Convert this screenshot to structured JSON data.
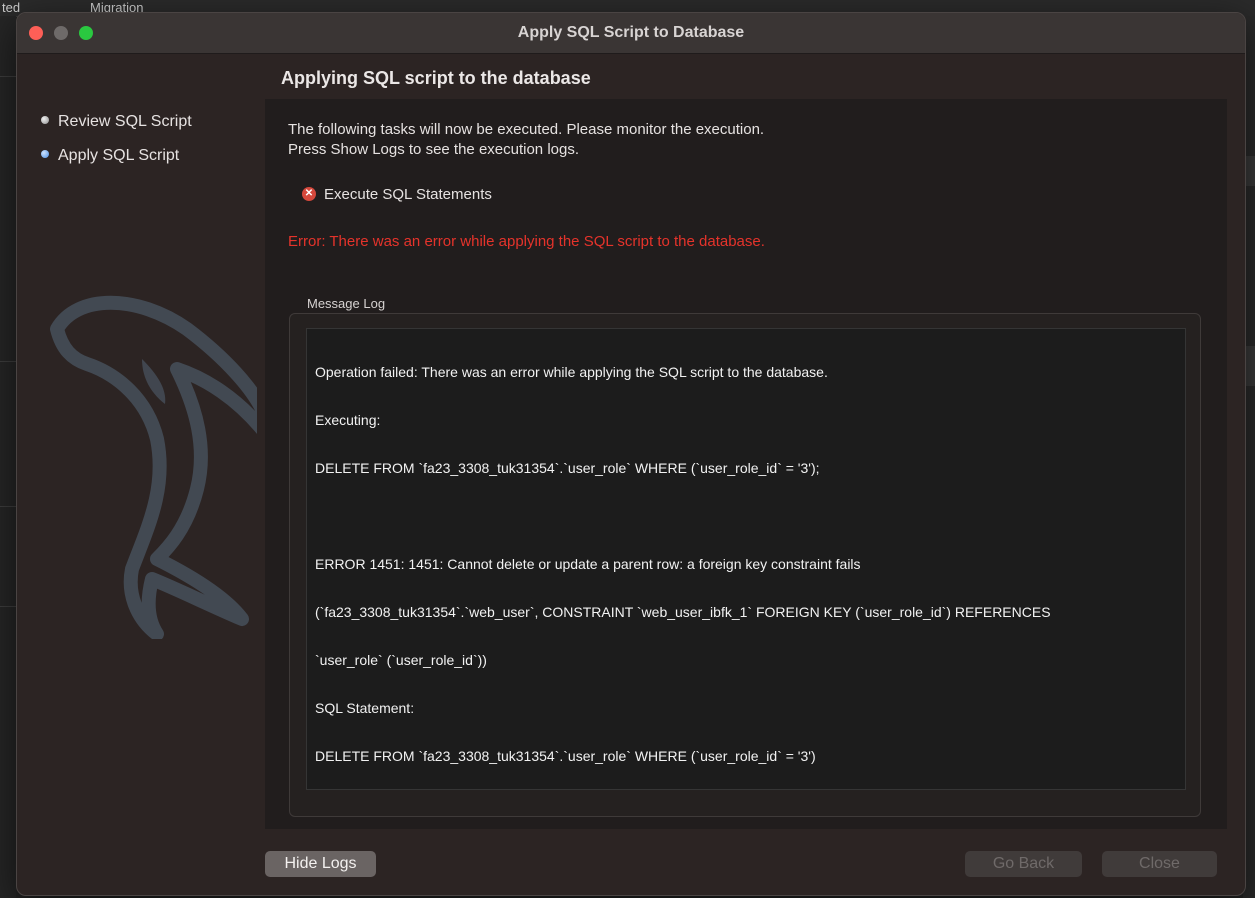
{
  "window": {
    "title": "Apply SQL Script to Database"
  },
  "sidebar": {
    "steps": [
      {
        "label": "Review SQL Script",
        "state": "done"
      },
      {
        "label": "Apply SQL Script",
        "state": "current"
      }
    ]
  },
  "main": {
    "title": "Applying SQL script to the database",
    "description_line1": "The following tasks will now be executed. Please monitor the execution.",
    "description_line2": "Press Show Logs to see the execution logs.",
    "task": {
      "label": "Execute SQL Statements",
      "status": "error"
    },
    "error_message": "Error: There was an error while applying the SQL script to the database.",
    "log": {
      "label": "Message Log",
      "lines": [
        "Operation failed: There was an error while applying the SQL script to the database.",
        "Executing:",
        "DELETE FROM `fa23_3308_tuk31354`.`user_role` WHERE (`user_role_id` = '3');",
        "",
        "ERROR 1451: 1451: Cannot delete or update a parent row: a foreign key constraint fails",
        "(`fa23_3308_tuk31354`.`web_user`, CONSTRAINT `web_user_ibfk_1` FOREIGN KEY (`user_role_id`) REFERENCES",
        "`user_role` (`user_role_id`))",
        "SQL Statement:",
        "DELETE FROM `fa23_3308_tuk31354`.`user_role` WHERE (`user_role_id` = '3')"
      ]
    }
  },
  "buttons": {
    "hide_logs": "Hide Logs",
    "go_back": "Go Back",
    "close": "Close"
  },
  "background": {
    "tab1": "ted",
    "tab2": "Migration"
  },
  "colors": {
    "error": "#e5332b",
    "window_bg": "#2c2423",
    "content_bg": "#211d1d",
    "close_dot": "#fe5f57",
    "zoom_dot": "#2ac840"
  }
}
